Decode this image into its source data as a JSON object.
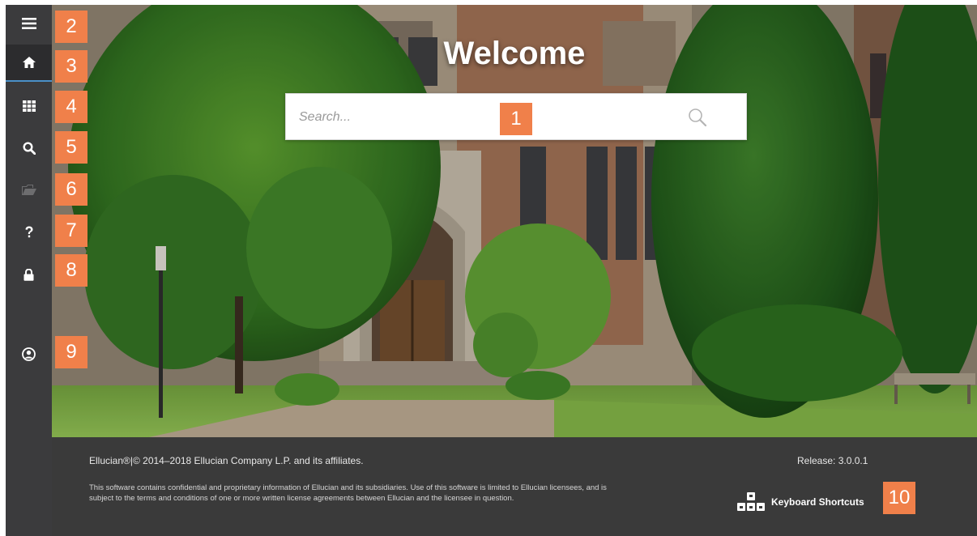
{
  "sidebar": {
    "items": [
      {
        "name": "menu",
        "icon": "hamburger-menu-icon"
      },
      {
        "name": "home",
        "icon": "home-icon"
      },
      {
        "name": "applications",
        "icon": "grid-icon"
      },
      {
        "name": "search",
        "icon": "search-icon"
      },
      {
        "name": "recently-opened",
        "icon": "folder-icon"
      },
      {
        "name": "help",
        "icon": "question-icon"
      },
      {
        "name": "sign-out",
        "icon": "lock-icon"
      },
      {
        "name": "profile",
        "icon": "user-circle-icon"
      }
    ]
  },
  "main": {
    "welcome": "Welcome",
    "search_placeholder": "Search..."
  },
  "footer": {
    "copyright": "Ellucian®|© 2014–2018 Ellucian Company L.P. and its affiliates.",
    "legal": "This software contains confidential and proprietary information of Ellucian and its subsidiaries. Use of this software is limited to Ellucian licensees, and is subject to the terms and conditions of one or more written license agreements between Ellucian and the licensee in question.",
    "release": "Release: 3.0.0.1",
    "keyboard_shortcuts": "Keyboard Shortcuts"
  },
  "callouts": [
    "1",
    "2",
    "3",
    "4",
    "5",
    "6",
    "7",
    "8",
    "9",
    "10"
  ],
  "colors": {
    "sidebar": "#3b3b3d",
    "footer": "#3a3a3a",
    "callout": "#f0804a",
    "active_indicator": "#4a90c8"
  }
}
